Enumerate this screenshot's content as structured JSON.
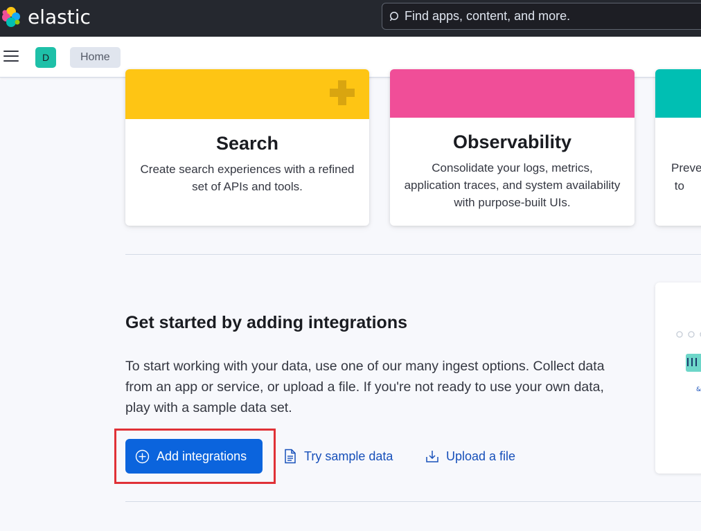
{
  "header": {
    "brand": "elastic",
    "search_placeholder": "Find apps, content, and more."
  },
  "subnav": {
    "space_initial": "D",
    "breadcrumb": "Home"
  },
  "solutions": [
    {
      "title": "Search",
      "description": "Create search experiences with a refined set of APIs and tools.",
      "banner_color": "#fec514"
    },
    {
      "title": "Observability",
      "description": "Consolidate your logs, metrics, application traces, and system availability with purpose-built UIs.",
      "banner_color": "#f04e98"
    },
    {
      "title": "",
      "description": "Preve… to…",
      "banner_color": "#00bfb3"
    }
  ],
  "integrations": {
    "title": "Get started by adding integrations",
    "description": "To start working with your data, use one of our many ingest options. Collect data from an app or service, or upload a file. If you're not ready to use your own data, play with a sample data set.",
    "add_button": "Add integrations",
    "sample_button": "Try sample data",
    "upload_button": "Upload a file"
  },
  "icons": {
    "search": "search-icon",
    "menu": "hamburger-menu-icon",
    "add": "plus-circle-icon",
    "sample": "document-icon",
    "upload": "upload-icon"
  }
}
